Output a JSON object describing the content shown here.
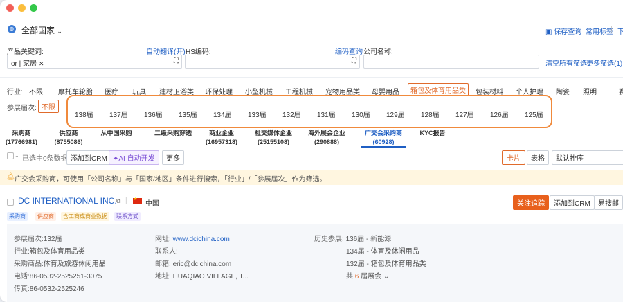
{
  "window": {
    "dots": [
      "#f25f58",
      "#fbbe3c",
      "#34c84a"
    ]
  },
  "header": {
    "region": "全部国家",
    "save_query": "保存查询",
    "common_tags": "常用标签",
    "more": "下"
  },
  "search": {
    "product_label": "产品关键词:",
    "auto_translate": "自动翻译(开)",
    "hs_label": "HS编码:",
    "hs_lookup": "编码查询",
    "company_label": "公司名称:",
    "product_tag": "or | 家居",
    "clear_all": "清空所有筛选",
    "more_filters": "更多筛选(1)"
  },
  "industry": {
    "label": "行业:",
    "items": [
      "不限",
      "摩托车轮胎",
      "医疗",
      "玩具",
      "建材卫浴类",
      "环保处理",
      "小型机械",
      "工程机械",
      "宠物用品类",
      "母婴用品",
      "箱包及体育用品类",
      "包装材料",
      "个人护理",
      "陶瓷",
      "照明",
      "赛"
    ],
    "active": "箱包及体育用品类"
  },
  "session": {
    "label": "参展届次:",
    "any": "不限",
    "items": [
      "138届",
      "137届",
      "136届",
      "135届",
      "134届",
      "133届",
      "132届",
      "131届",
      "130届",
      "129届",
      "128届",
      "127届",
      "126届",
      "125届"
    ]
  },
  "tabs": [
    {
      "name": "采购商",
      "count": "(17766981)"
    },
    {
      "name": "供应商",
      "count": "(8755086)"
    },
    {
      "name": "从中国采购",
      "count": ""
    },
    {
      "name": "二级采购穿透",
      "count": ""
    },
    {
      "name": "商业企业",
      "count": "(16957318)"
    },
    {
      "name": "社交媒体企业",
      "count": "(25155108)"
    },
    {
      "name": "海外展会企业",
      "count": "(290888)"
    },
    {
      "name": "广交会采购商",
      "count": "(60928)"
    },
    {
      "name": "KYC报告",
      "count": ""
    }
  ],
  "toolbar": {
    "selected": "已选中0条数据",
    "add_crm": "添加到CRM",
    "ai": "AI 自动开发",
    "more": "更多",
    "card": "卡片",
    "table": "表格",
    "sort": "默认排序"
  },
  "notice": "广交会采购商，可使用「公司名称」与「国家/地区」条件进行搜索，「行业」/「参展届次」作为筛选。",
  "company": {
    "name": "DC INTERNATIONAL INC.",
    "country": "中国",
    "follow": "关注追踪",
    "add_crm": "添加到CRM",
    "easy_search": "易搜邮",
    "tags": [
      "采购商",
      "供应商",
      "含工商或商业数据",
      "联系方式"
    ],
    "session_label": "参展届次:",
    "session": "132届",
    "industry_label": "行业:",
    "industry": "箱包及体育用品类",
    "goods_label": "采购商品:",
    "goods": "体育及旅游休闲用品",
    "phone_label": "电话:",
    "phone": "86-0532-2525251-3075",
    "fax_label": "传真:",
    "fax": "86-0532-2525246",
    "site_label": "网址:",
    "site": "www.dcichina.com",
    "contact_label": "联系人:",
    "email_label": "邮箱:",
    "email": "eric@dcichina.com",
    "addr_label": "地址:",
    "addr": "HUAQIAO VILLAGE, T...",
    "history_label": "历史参展:",
    "history": [
      "136届 - 新能源",
      "134届 - 体育及休闲用品",
      "132届 - 箱包及体育用品类"
    ],
    "total_pre": "共",
    "total_num": "6",
    "total_post": "届展会"
  }
}
